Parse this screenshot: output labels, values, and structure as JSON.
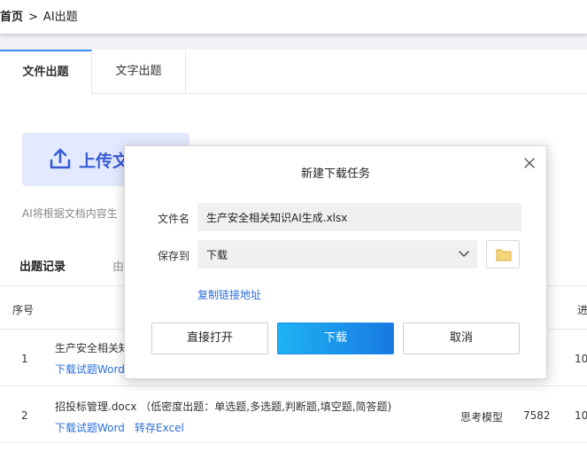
{
  "breadcrumb": {
    "home": "首页",
    "separator": ">",
    "current": "AI出题"
  },
  "tabs": [
    {
      "label": "文件出题",
      "active": true
    },
    {
      "label": "文字出题",
      "active": false
    }
  ],
  "upload": {
    "label": "上传文",
    "icon": "upload-icon"
  },
  "hint": "AI将根据文档内容生",
  "records": {
    "title": "出题记录",
    "subtitle": "由"
  },
  "table": {
    "headers": {
      "index": "序号",
      "progress": "进"
    },
    "rows": [
      {
        "index": "1",
        "name": "生产安全相关知",
        "action1": "下载试题Word",
        "count_partial": "10"
      },
      {
        "index": "2",
        "name": "招投标管理.docx （低密度出题：单选题,多选题,判断题,填空题,简答题)",
        "action1": "下载试题Word",
        "action2": "转存Excel",
        "model": "思考模型",
        "number": "7582",
        "count_partial": "10"
      }
    ]
  },
  "dialog": {
    "title": "新建下载任务",
    "filename_label": "文件名",
    "filename": "生产安全相关知识AI生成.xlsx",
    "saveto_label": "保存到",
    "saveto_value": "下载",
    "copy_link": "复制链接地址",
    "buttons": {
      "open": "直接打开",
      "download": "下载",
      "cancel": "取消"
    }
  },
  "colors": {
    "accent": "#2a6ed9",
    "download_start": "#1fb3f5",
    "download_end": "#1779e0",
    "upload_bg": "#e3eaff",
    "folder": "#e8c25a"
  }
}
